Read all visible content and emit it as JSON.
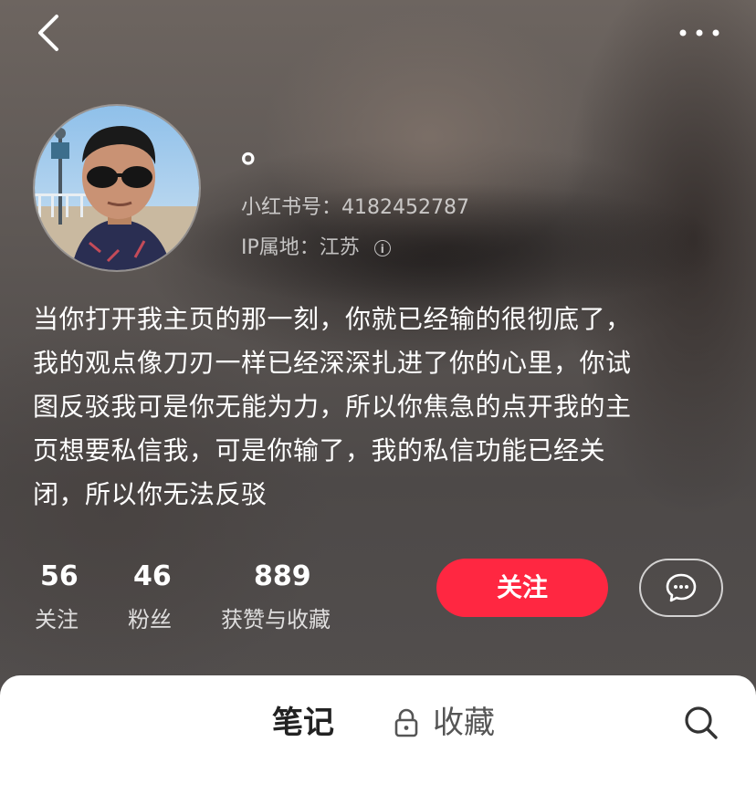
{
  "profile": {
    "nickname": "。",
    "account_id": "小红书号：4182452787",
    "ip_location": "IP属地：江苏",
    "bio_lines": [
      "当你打开我主页的那一刻，你就已经输的很彻底了，",
      "我的观点像刀刃一样已经深深扎进了你的心里，你试",
      "图反驳我可是你无能为力，所以你焦急的点开我的主",
      "页想要私信我，可是你输了，我的私信功能已经关",
      "闭，所以你无法反驳"
    ]
  },
  "stats": [
    {
      "value": "56",
      "label": "关注"
    },
    {
      "value": "46",
      "label": "粉丝"
    },
    {
      "value": "889",
      "label": "获赞与收藏"
    }
  ],
  "actions": {
    "follow_label": "关注"
  },
  "tabs": {
    "notes": "笔记",
    "collections": "收藏"
  },
  "icons": {
    "back": "chevron-left-icon",
    "more": "more-dots-icon",
    "info": "info-icon",
    "message": "chat-bubble-icon",
    "lock": "lock-icon",
    "search": "search-icon"
  },
  "colors": {
    "accent": "#ff2741",
    "panel": "#ffffff"
  }
}
